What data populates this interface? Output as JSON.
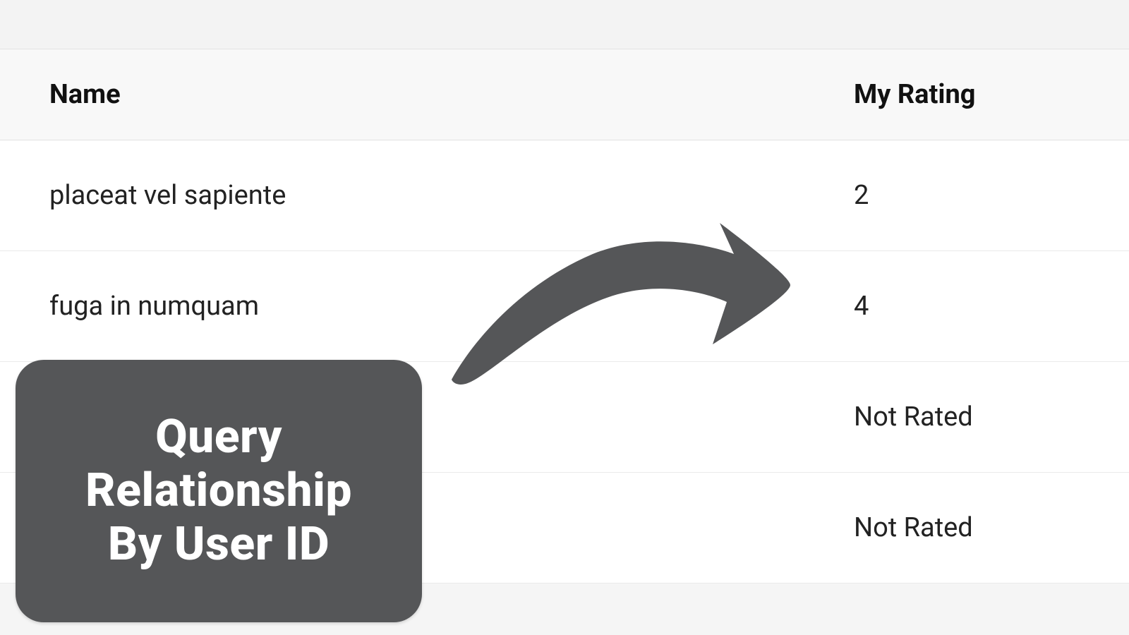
{
  "columns": {
    "name": "Name",
    "rating": "My Rating"
  },
  "not_rated_label": "Not Rated",
  "rows": [
    {
      "name": "placeat vel sapiente",
      "rating": "2",
      "rated": true
    },
    {
      "name": "fuga in numquam",
      "rating": "4",
      "rated": true
    },
    {
      "name": "",
      "rating": "Not Rated",
      "rated": false
    },
    {
      "name": "",
      "rating": "Not Rated",
      "rated": false
    }
  ],
  "callout": {
    "line1": "Query",
    "line2": "Relationship",
    "line3": "By User ID"
  }
}
